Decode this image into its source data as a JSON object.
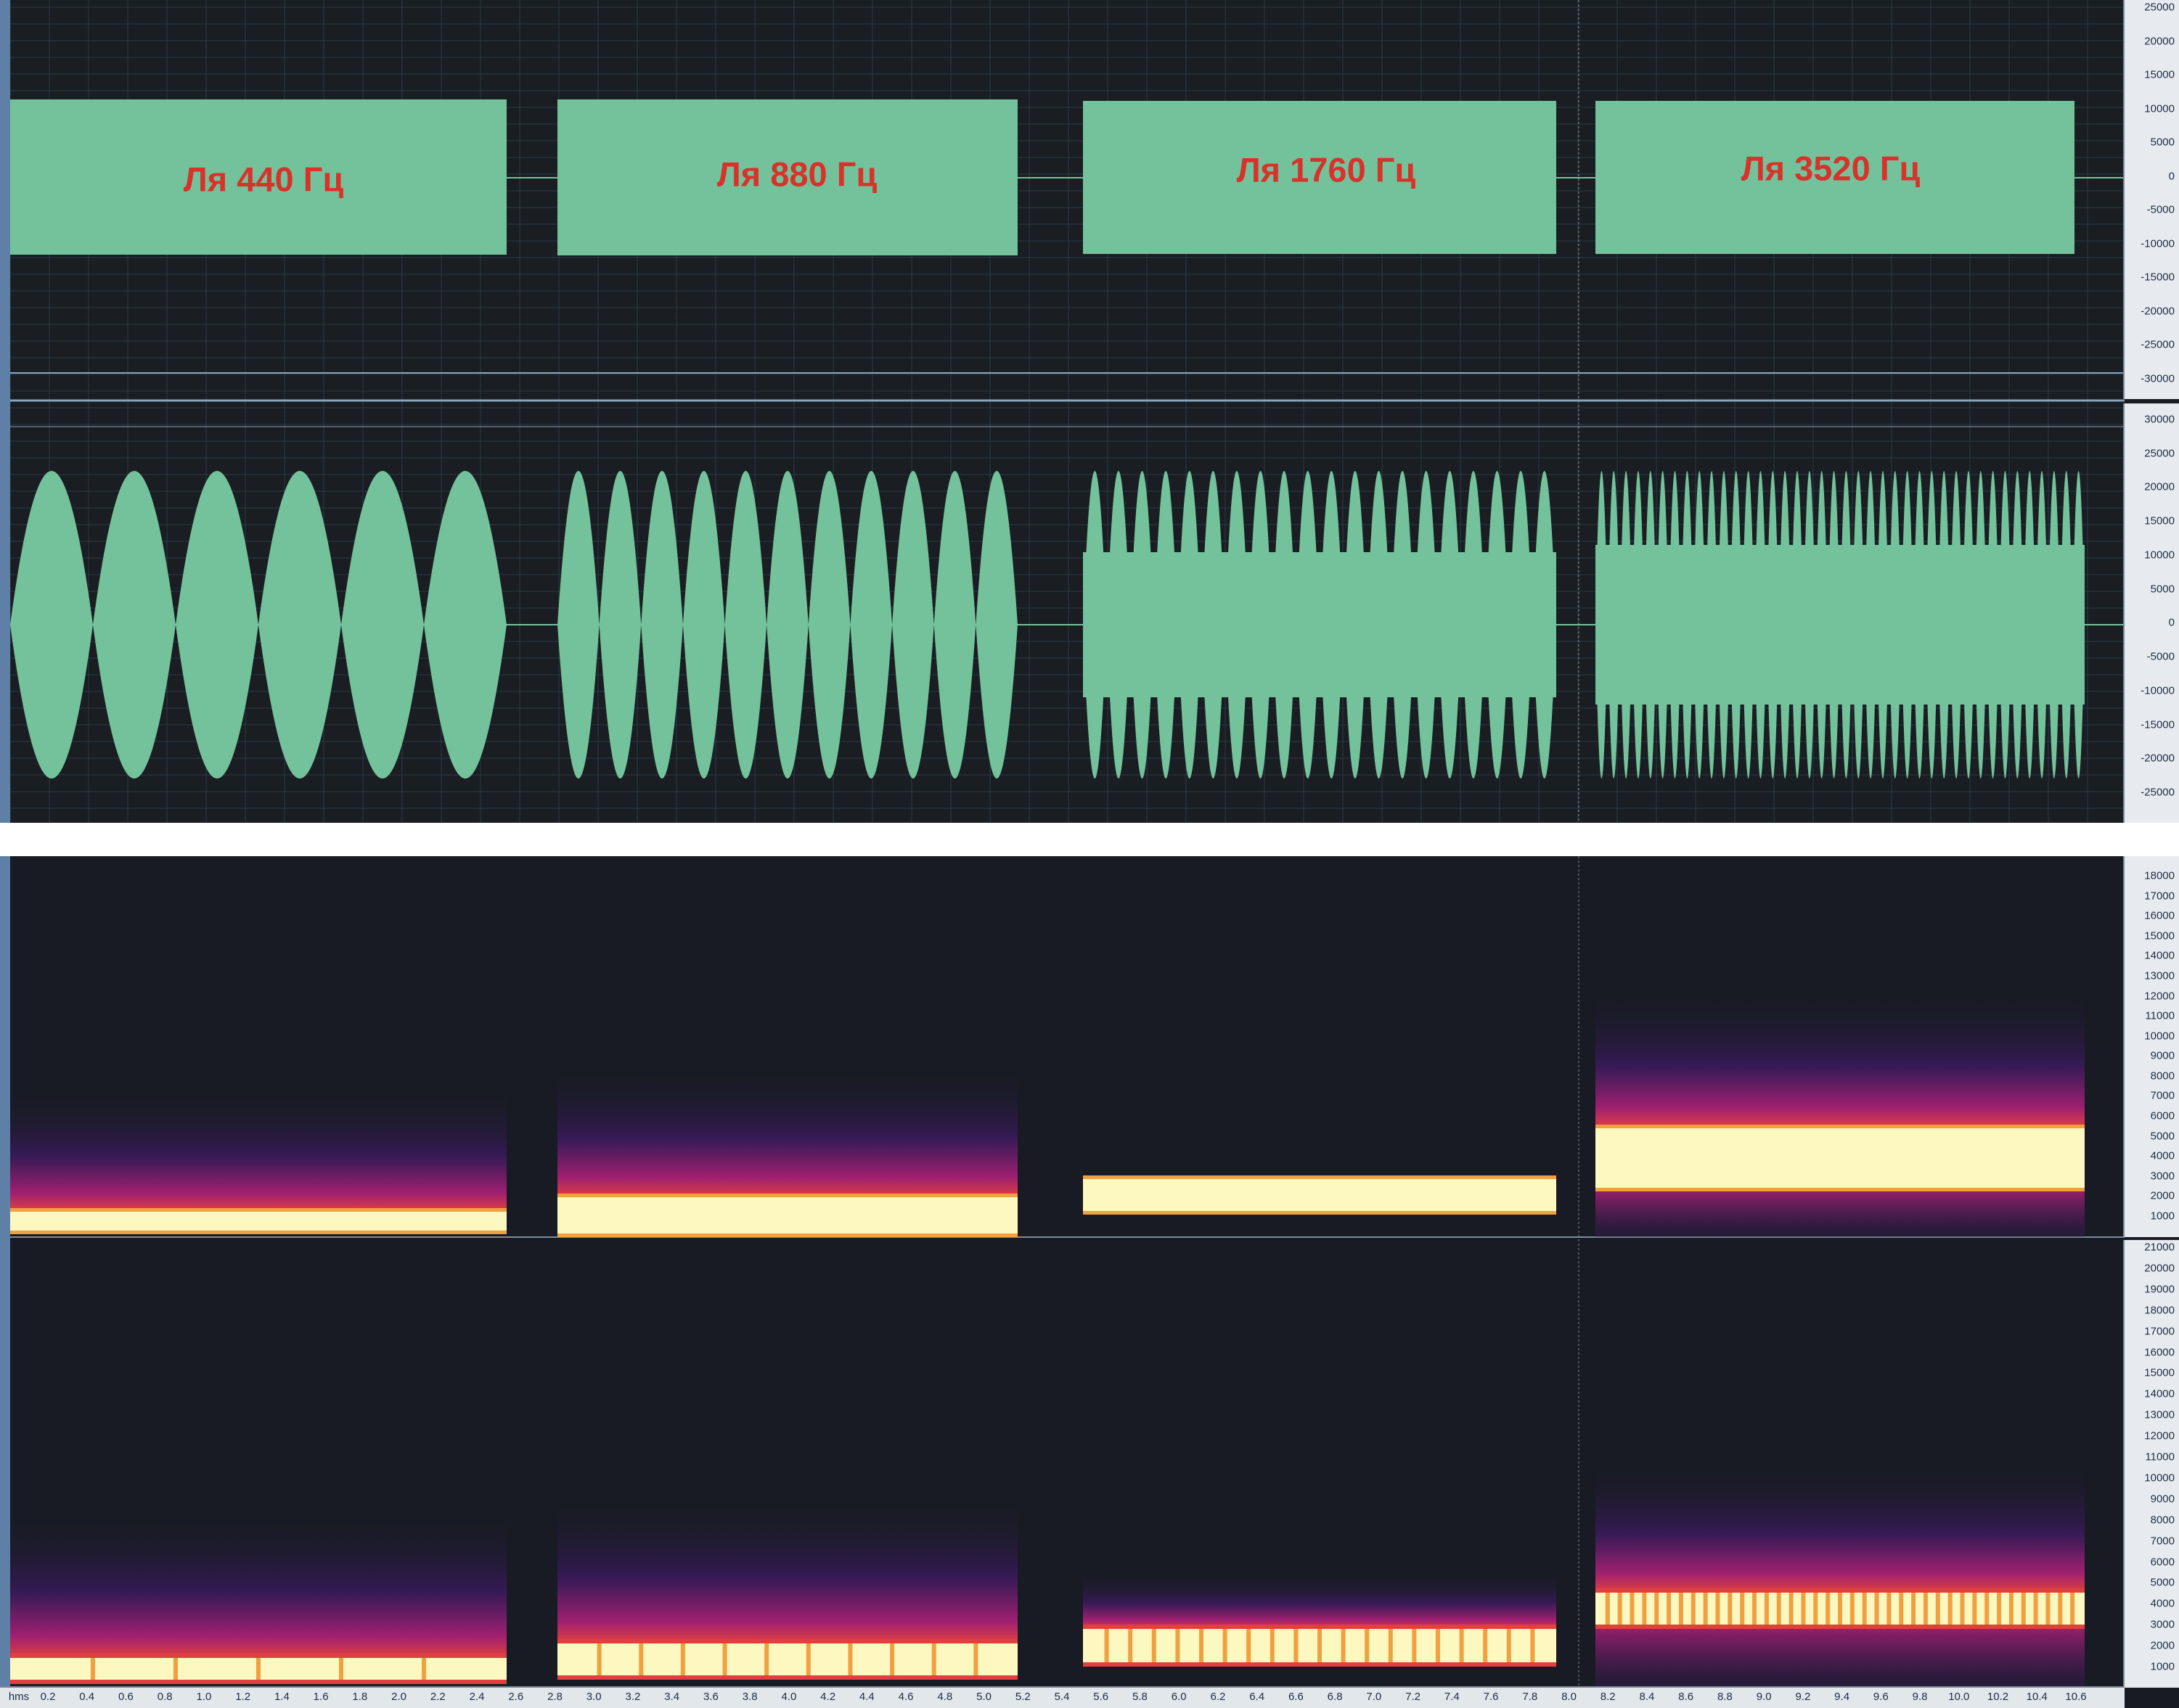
{
  "window": {
    "title": ""
  },
  "segments": [
    {
      "label": "Ля 440 Гц"
    },
    {
      "label": "Ля 880 Гц"
    },
    {
      "label": "Ля 1760 Гц"
    },
    {
      "label": "Ля 3520 Гц"
    }
  ],
  "waveform_panel": {
    "top_channel": {
      "amplitude_labels": [
        "25000",
        "20000",
        "15000",
        "10000",
        "5000",
        "0",
        "-5000",
        "-10000",
        "-15000",
        "-20000",
        "-25000",
        "-30000"
      ]
    },
    "bottom_channel": {
      "amplitude_labels": [
        "30000",
        "25000",
        "20000",
        "15000",
        "10000",
        "5000",
        "0",
        "-5000",
        "-10000",
        "-15000",
        "-20000",
        "-25000"
      ]
    }
  },
  "spectrogram_panel": {
    "top_channel": {
      "freq_labels": [
        "18000",
        "17000",
        "16000",
        "15000",
        "14000",
        "13000",
        "12000",
        "11000",
        "10000",
        "9000",
        "8000",
        "7000",
        "6000",
        "5000",
        "4000",
        "3000",
        "2000",
        "1000"
      ]
    },
    "bottom_channel": {
      "freq_labels": [
        "21000",
        "20000",
        "19000",
        "18000",
        "17000",
        "16000",
        "15000",
        "14000",
        "13000",
        "12000",
        "11000",
        "10000",
        "9000",
        "8000",
        "7000",
        "6000",
        "5000",
        "4000",
        "3000",
        "2000",
        "1000"
      ]
    }
  },
  "time_ruler": {
    "unit": "hms",
    "ticks": [
      "0.2",
      "0.4",
      "0.6",
      "0.8",
      "1.0",
      "1.2",
      "1.4",
      "1.6",
      "1.8",
      "2.0",
      "2.2",
      "2.4",
      "2.6",
      "2.8",
      "3.0",
      "3.2",
      "3.4",
      "3.6",
      "3.8",
      "4.0",
      "4.2",
      "4.4",
      "4.6",
      "4.8",
      "5.0",
      "5.2",
      "5.4",
      "5.6",
      "5.8",
      "6.0",
      "6.2",
      "6.4",
      "6.6",
      "6.8",
      "7.0",
      "7.2",
      "7.4",
      "7.6",
      "7.8",
      "8.0",
      "8.2",
      "8.4",
      "8.6",
      "8.8",
      "9.0",
      "9.2",
      "9.4",
      "9.6",
      "9.8",
      "10.0",
      "10.2",
      "10.4",
      "10.6"
    ]
  },
  "colors": {
    "background_wave": "#1a1d21",
    "background_spectrogram": "#181b24",
    "grid": "#2a3a4a",
    "waveform": "#73c29b",
    "label": "#d8322a",
    "spectrum_hot": "#fdf7c0",
    "spectrum_orange": "#f0a040",
    "spectrum_red": "#e04040",
    "spectrum_magenta": "#a02070",
    "spectrum_purple": "#3a1a5c"
  }
}
